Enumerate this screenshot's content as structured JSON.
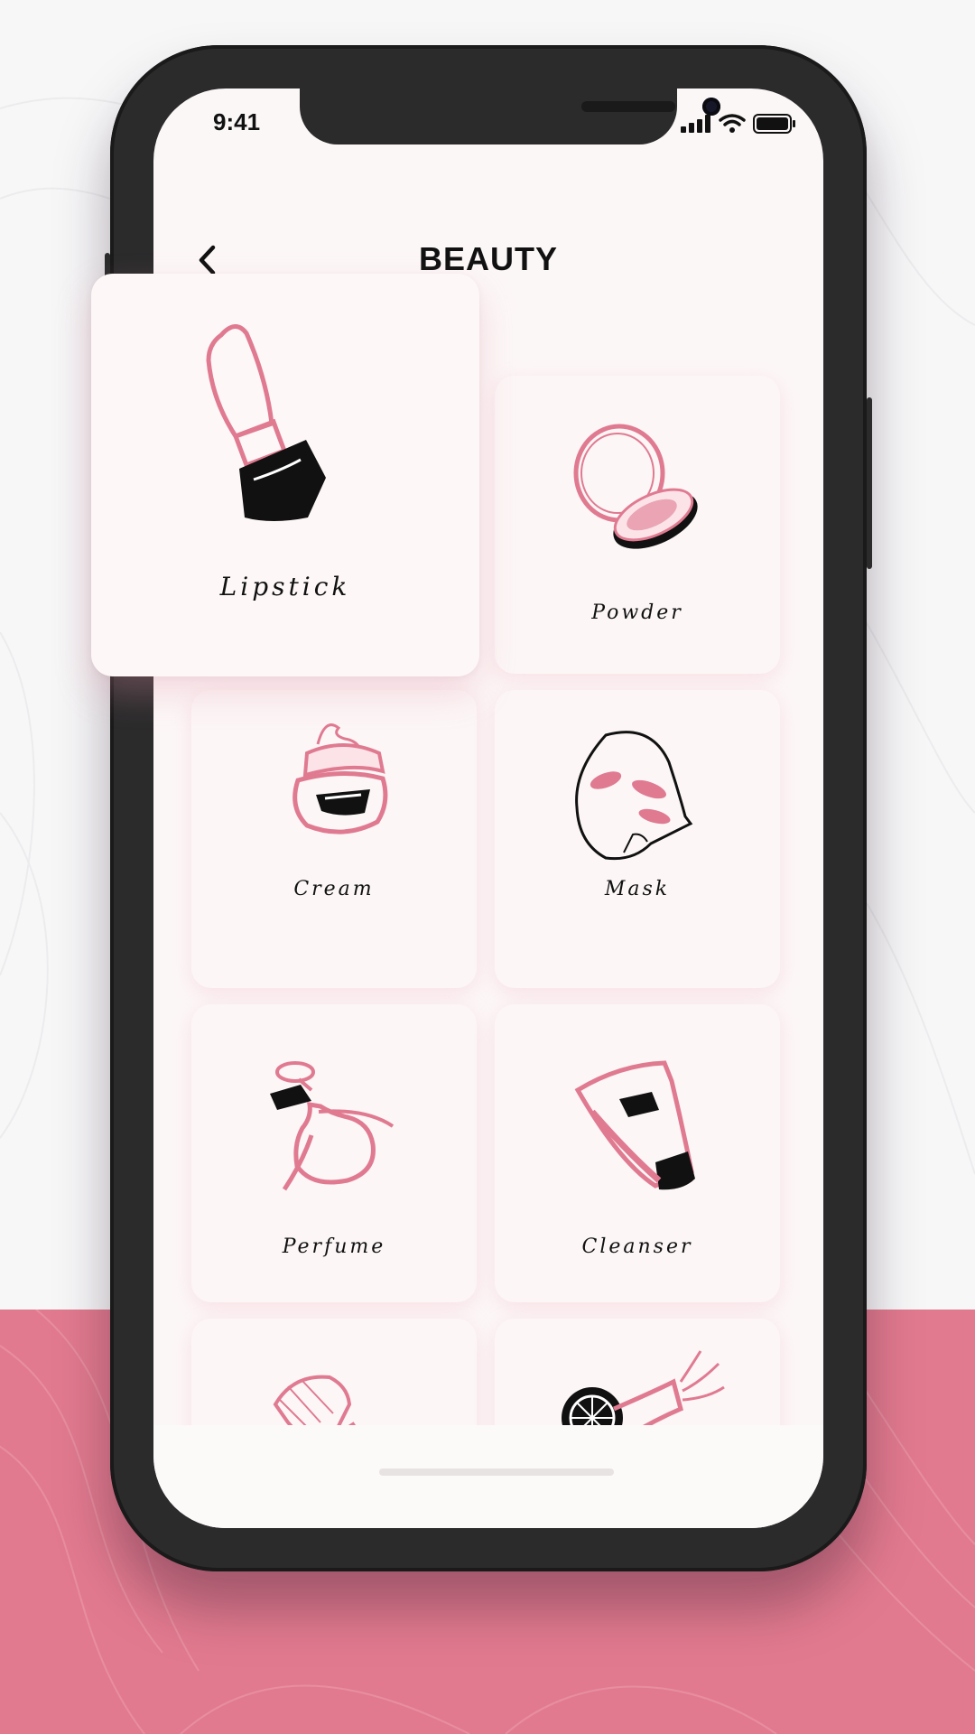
{
  "status_bar": {
    "time": "9:41"
  },
  "header": {
    "title": "BEAUTY",
    "back_icon": "chevron-left-icon"
  },
  "categories": [
    {
      "label": "Lipstick",
      "icon": "lipstick-icon"
    },
    {
      "label": "Powder",
      "icon": "powder-compact-icon"
    },
    {
      "label": "Cream",
      "icon": "cream-jar-icon"
    },
    {
      "label": "Mask",
      "icon": "face-mask-icon"
    },
    {
      "label": "Perfume",
      "icon": "perfume-bottle-icon"
    },
    {
      "label": "Cleanser",
      "icon": "cleanser-tube-icon"
    },
    {
      "label": "",
      "icon": "makeup-brush-icon"
    },
    {
      "label": "",
      "icon": "hair-dryer-icon"
    }
  ],
  "colors": {
    "accent": "#e27a8f",
    "card": "#fcf6f6",
    "ink": "#111111"
  }
}
